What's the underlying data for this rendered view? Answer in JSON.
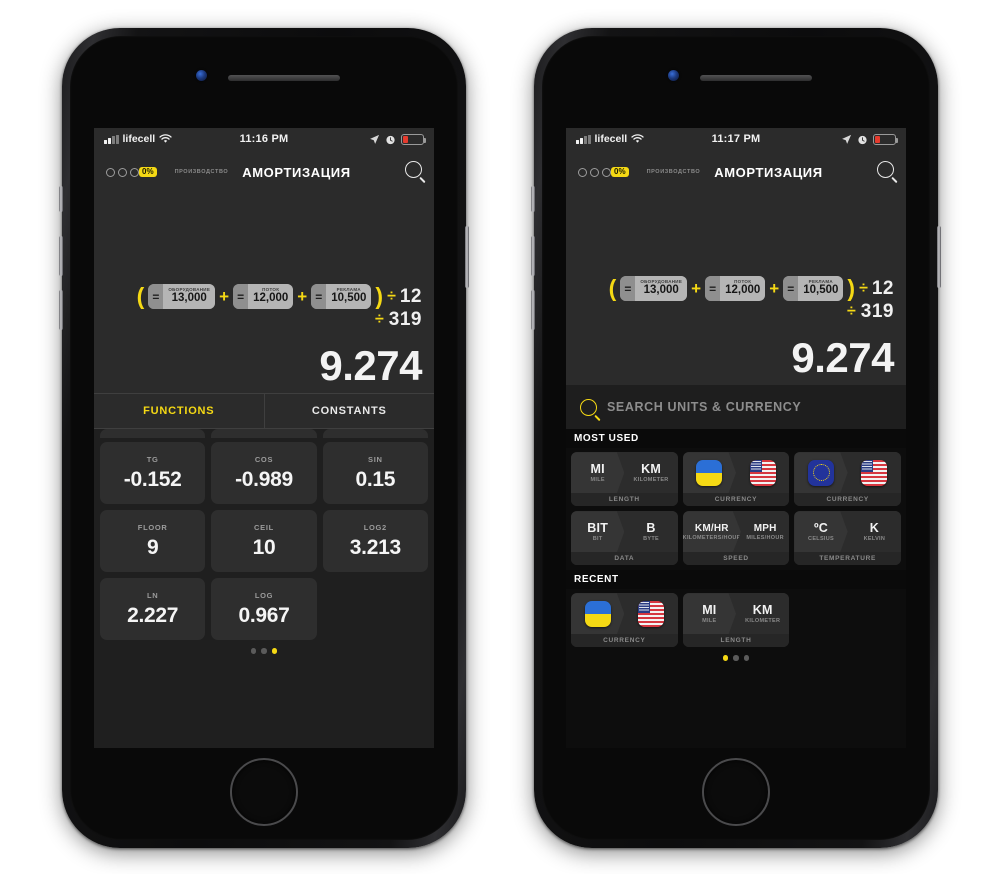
{
  "background_color": "#ffffff",
  "accent_color": "#f5d914",
  "phones": [
    {
      "id": "left",
      "status_bar": {
        "carrier": "lifecell",
        "time": "11:16 PM",
        "wifi_icon": "wifi-icon",
        "signal_icon": "signal-bars-icon",
        "location_icon": "location-arrow-icon",
        "alarm_icon": "alarm-clock-icon",
        "battery_icon": "battery-low-icon"
      },
      "nav": {
        "badge_text": "0%",
        "subtitle": "ПРОИЗВОДСТВО",
        "title": "АМОРТИЗАЦИЯ",
        "search_icon": "search-icon"
      },
      "calc": {
        "open_paren": "(",
        "close_paren": ")",
        "terms": [
          {
            "eq": "=",
            "label": "ОБОРУДОВАНИЕ",
            "value": "13,000"
          },
          {
            "eq": "=",
            "label": "ПОТОК",
            "value": "12,000"
          },
          {
            "eq": "=",
            "label": "РЕКЛАМА",
            "value": "10,500"
          }
        ],
        "operator": "+",
        "divisions": [
          {
            "symbol": "÷",
            "value": "12"
          },
          {
            "symbol": "÷",
            "value": "319"
          }
        ],
        "result": "9.274"
      },
      "tabs": [
        {
          "label": "FUNCTIONS",
          "active": true
        },
        {
          "label": "CONSTANTS",
          "active": false
        }
      ],
      "functions": [
        [
          {
            "label": "TG",
            "value": "-0.152"
          },
          {
            "label": "COS",
            "value": "-0.989"
          },
          {
            "label": "SIN",
            "value": "0.15"
          }
        ],
        [
          {
            "label": "FLOOR",
            "value": "9"
          },
          {
            "label": "CEIL",
            "value": "10"
          },
          {
            "label": "LOG2",
            "value": "3.213"
          }
        ],
        [
          {
            "label": "LN",
            "value": "2.227"
          },
          {
            "label": "LOG",
            "value": "0.967"
          }
        ]
      ],
      "page_dots": {
        "count": 3,
        "active_index": 2
      }
    },
    {
      "id": "right",
      "status_bar": {
        "carrier": "lifecell",
        "time": "11:17 PM",
        "wifi_icon": "wifi-icon",
        "signal_icon": "signal-bars-icon",
        "location_icon": "location-arrow-icon",
        "alarm_icon": "alarm-clock-icon",
        "battery_icon": "battery-low-icon"
      },
      "nav": {
        "badge_text": "0%",
        "subtitle": "ПРОИЗВОДСТВО",
        "title": "АМОРТИЗАЦИЯ",
        "search_icon": "search-icon"
      },
      "calc": {
        "open_paren": "(",
        "close_paren": ")",
        "terms": [
          {
            "eq": "=",
            "label": "ОБОРУДОВАНИЕ",
            "value": "13,000"
          },
          {
            "eq": "=",
            "label": "ПОТОК",
            "value": "12,000"
          },
          {
            "eq": "=",
            "label": "РЕКЛАМА",
            "value": "10,500"
          }
        ],
        "operator": "+",
        "divisions": [
          {
            "symbol": "÷",
            "value": "12"
          },
          {
            "symbol": "÷",
            "value": "319"
          }
        ],
        "result": "9.274"
      },
      "search": {
        "icon": "search-icon",
        "placeholder": "SEARCH UNITS & CURRENCY",
        "value": ""
      },
      "sections": [
        {
          "header": "MOST USED",
          "rows": [
            [
              {
                "from": {
                  "abbr": "MI",
                  "name": "MILE",
                  "kind": "text"
                },
                "to": {
                  "abbr": "KM",
                  "name": "KILOMETER",
                  "kind": "text"
                },
                "category": "LENGTH"
              },
              {
                "from": {
                  "flag": "ua",
                  "kind": "flag"
                },
                "to": {
                  "flag": "us",
                  "kind": "flag"
                },
                "category": "CURRENCY"
              },
              {
                "from": {
                  "flag": "eu",
                  "kind": "flag"
                },
                "to": {
                  "flag": "us",
                  "kind": "flag"
                },
                "category": "CURRENCY"
              }
            ],
            [
              {
                "from": {
                  "abbr": "BIT",
                  "name": "BIT",
                  "kind": "text"
                },
                "to": {
                  "abbr": "B",
                  "name": "BYTE",
                  "kind": "text"
                },
                "category": "DATA"
              },
              {
                "from": {
                  "abbr": "KM/HR",
                  "name": "KILOMETERS/HOUR",
                  "kind": "text"
                },
                "to": {
                  "abbr": "MPH",
                  "name": "MILES/HOUR",
                  "kind": "text"
                },
                "category": "SPEED"
              },
              {
                "from": {
                  "abbr": "ºC",
                  "name": "CELSIUS",
                  "kind": "text"
                },
                "to": {
                  "abbr": "K",
                  "name": "KELVIN",
                  "kind": "text"
                },
                "category": "TEMPERATURE"
              }
            ]
          ]
        },
        {
          "header": "RECENT",
          "rows": [
            [
              {
                "from": {
                  "flag": "ua",
                  "kind": "flag"
                },
                "to": {
                  "flag": "us",
                  "kind": "flag"
                },
                "category": "CURRENCY"
              },
              {
                "from": {
                  "abbr": "MI",
                  "name": "MILE",
                  "kind": "text"
                },
                "to": {
                  "abbr": "KM",
                  "name": "KILOMETER",
                  "kind": "text"
                },
                "category": "LENGTH"
              },
              {
                "empty": true
              }
            ]
          ]
        }
      ],
      "page_dots": {
        "count": 3,
        "active_index": 0
      }
    }
  ]
}
